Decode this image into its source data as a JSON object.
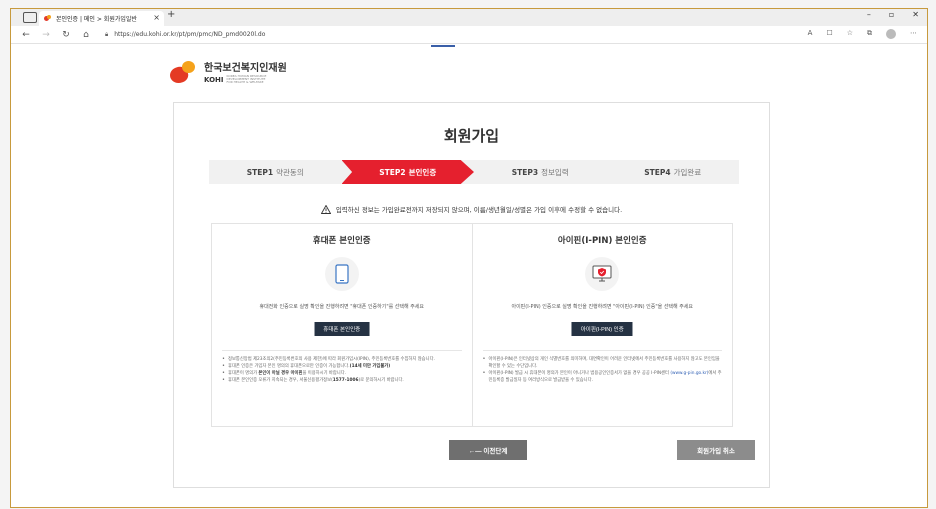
{
  "browser": {
    "tab_title": "본인인증 | 메인 > 회원가입일반 ",
    "tab_close": "×",
    "new_tab": "+",
    "url": "https://edu.kohi.or.kr/pt/pm/pmc/ND_pmd0020l.do",
    "win_minimize": "–",
    "win_restore": "▫",
    "win_close": "✕"
  },
  "logo": {
    "korean": "한국보건복지인재원",
    "english": "KOHI",
    "english_sub": "KOREA HUMAN RESOURCE DEVELOPMENT INSTITUTE FOR HEALTH & WELFARE"
  },
  "page": {
    "title": "회원가입",
    "warning": "입력하신 정보는 가입완료전까지 저장되지 않으며, 이름/생년월일/성별은 가입 이후에 수정할 수 없습니다."
  },
  "steps": [
    {
      "num": "STEP1",
      "label": "약관동의"
    },
    {
      "num": "STEP2",
      "label": "본인인증"
    },
    {
      "num": "STEP3",
      "label": "정보입력"
    },
    {
      "num": "STEP4",
      "label": "가입완료"
    }
  ],
  "phone": {
    "title": "휴대폰 본인인증",
    "desc": "휴대전화 인증으로 실명 확인을 진행하려면 \"휴대폰 인증하기\"를 선택해 주세요",
    "button": "휴대폰 본인인증",
    "notes": [
      {
        "pre": "정보통신망법 제23조의2(주민등록번호의 사용 제한)에 따라 회원가입시(IPIN), 주민등록번호를 수집하지 않습니다.",
        "bold": "",
        "post": ""
      },
      {
        "pre": "휴대폰 인증은 가입자 본인 명의의 휴대폰으로만 인증이 가능합니다.",
        "bold": "(14세 미만 가입불가)",
        "post": ""
      },
      {
        "pre": "휴대폰이 명의가 ",
        "bold": "본인이 아닐 경우 아이핀",
        "post": "을 이용하시기 바랍니다."
      },
      {
        "pre": "휴대폰 본인인증 오류가 지속되는 경우, 서울신용평가정보(",
        "bold": "1577-1006",
        "post": ")로 문의하시기 바랍니다."
      }
    ]
  },
  "ipin": {
    "title": "아이핀(I-PIN) 본인인증",
    "desc": "아이핀(I-PIN) 인증으로 실명 확인을 진행하려면 \"아이핀(I-PIN) 인증\"을 선택해 주세요",
    "button": "아이핀(I-PIN) 인증",
    "notes": [
      {
        "pre": "아이핀(I-PIN)은 인터넷상의 개인 식별번호를 의미하며, 대면확인이 어려운 인터넷에서 주민등록번호를 사용하지 않고도 본인임을 확인할 수 있는 수단입니다.",
        "link": "",
        "post": ""
      },
      {
        "pre": "아이핀(I-PIN) 발급 시 휴대폰이 명의가 본인이 아니거나 범용공인인증서가 없을 경우 공공 I-PIN센터 ",
        "link": "(www.g-pin.go.kr)",
        "post": "에서 주민등록증 발급일자 등 여러방식으로 발급받을 수 있습니다."
      }
    ]
  },
  "buttons": {
    "prev": "←— 이전단계",
    "cancel": "회원가입 취소"
  }
}
